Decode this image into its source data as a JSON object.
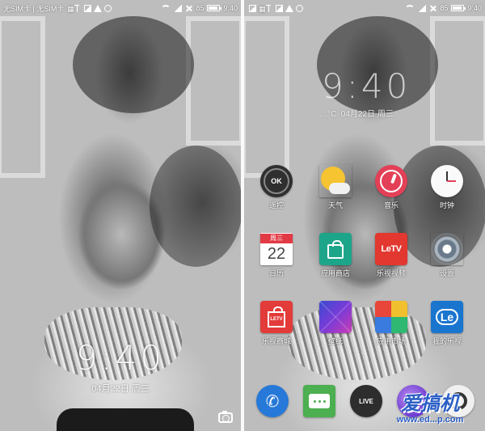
{
  "left_screen": {
    "statusbar": {
      "carrier": "无SIM卡 | 无SIM卡",
      "battery": "85",
      "battery_level": 0.85,
      "time": "9:40"
    },
    "clock": "9:40",
    "date": "04月22日 周三"
  },
  "right_screen": {
    "statusbar": {
      "battery": "85",
      "battery_level": 0.85,
      "time": "9:40"
    },
    "clock_widget": {
      "time": "9:40",
      "temp": "…°C",
      "date": "04月22日 周三"
    },
    "apps": [
      {
        "label": "遥控",
        "icon": "remote-icon",
        "icon_text": "OK"
      },
      {
        "label": "天气",
        "icon": "weather-icon"
      },
      {
        "label": "音乐",
        "icon": "music-icon"
      },
      {
        "label": "时钟",
        "icon": "clock-icon"
      },
      {
        "label": "日历",
        "icon": "calendar-icon",
        "weekday": "周三",
        "day": "22"
      },
      {
        "label": "应用商店",
        "icon": "app-store-icon"
      },
      {
        "label": "乐视视频",
        "icon": "letv-video-icon",
        "icon_text": "LeTV"
      },
      {
        "label": "设置",
        "icon": "settings-gear-icon"
      },
      {
        "label": "乐视商城",
        "icon": "letv-shop-icon",
        "icon_text": "LETV"
      },
      {
        "label": "壁纸",
        "icon": "wallpaper-icon"
      },
      {
        "label": "应用市场",
        "icon": "app-market-icon"
      },
      {
        "label": "我的乐视",
        "icon": "my-letv-cloud-icon",
        "icon_text": "Le"
      }
    ],
    "dock": [
      {
        "icon": "phone-icon"
      },
      {
        "icon": "messages-icon"
      },
      {
        "icon": "live-icon",
        "icon_text": "LIVE"
      },
      {
        "icon": "browser-icon"
      },
      {
        "icon": "camera-icon"
      }
    ]
  },
  "watermark": {
    "text": "爱搞机",
    "url": "www.ed...p.com"
  },
  "colors": {
    "music": "#e34057",
    "letv_red": "#e2382f",
    "store_green": "#1da58a",
    "phone_blue": "#2679d8",
    "msg_green": "#4caf50",
    "watermark_blue": "#2b5fc5"
  }
}
